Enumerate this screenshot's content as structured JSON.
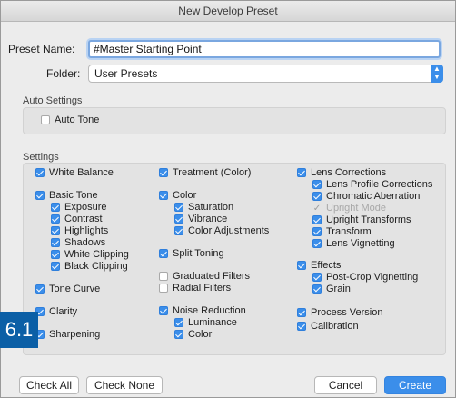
{
  "window": {
    "title": "New Develop Preset"
  },
  "preset_name": {
    "label": "Preset Name:",
    "value": "#Master Starting Point"
  },
  "folder": {
    "label": "Folder:",
    "value": "User Presets"
  },
  "auto_settings": {
    "title": "Auto Settings",
    "auto_tone": "Auto Tone"
  },
  "settings": {
    "title": "Settings",
    "col1": {
      "white_balance": "White Balance",
      "basic_tone": "Basic Tone",
      "exposure": "Exposure",
      "contrast": "Contrast",
      "highlights": "Highlights",
      "shadows": "Shadows",
      "white_clipping": "White Clipping",
      "black_clipping": "Black Clipping",
      "tone_curve": "Tone Curve",
      "clarity": "Clarity",
      "sharpening": "Sharpening"
    },
    "col2": {
      "treatment": "Treatment (Color)",
      "color": "Color",
      "saturation": "Saturation",
      "vibrance": "Vibrance",
      "color_adjustments": "Color Adjustments",
      "split_toning": "Split Toning",
      "graduated_filters": "Graduated Filters",
      "radial_filters": "Radial Filters",
      "noise_reduction": "Noise Reduction",
      "luminance": "Luminance",
      "nr_color": "Color"
    },
    "col3": {
      "lens_corrections": "Lens Corrections",
      "lens_profile": "Lens Profile Corrections",
      "chromatic": "Chromatic Aberration",
      "upright_mode": "Upright Mode",
      "upright_transforms": "Upright Transforms",
      "transform": "Transform",
      "lens_vignetting": "Lens Vignetting",
      "effects": "Effects",
      "post_crop": "Post-Crop Vignetting",
      "grain": "Grain",
      "process_version": "Process Version",
      "calibration": "Calibration"
    }
  },
  "buttons": {
    "check_all": "Check All",
    "check_none": "Check None",
    "cancel": "Cancel",
    "create": "Create"
  },
  "overlay": {
    "badge": "6.1"
  },
  "colors": {
    "accent": "#3b8eea",
    "badge": "#0b5fa6"
  }
}
